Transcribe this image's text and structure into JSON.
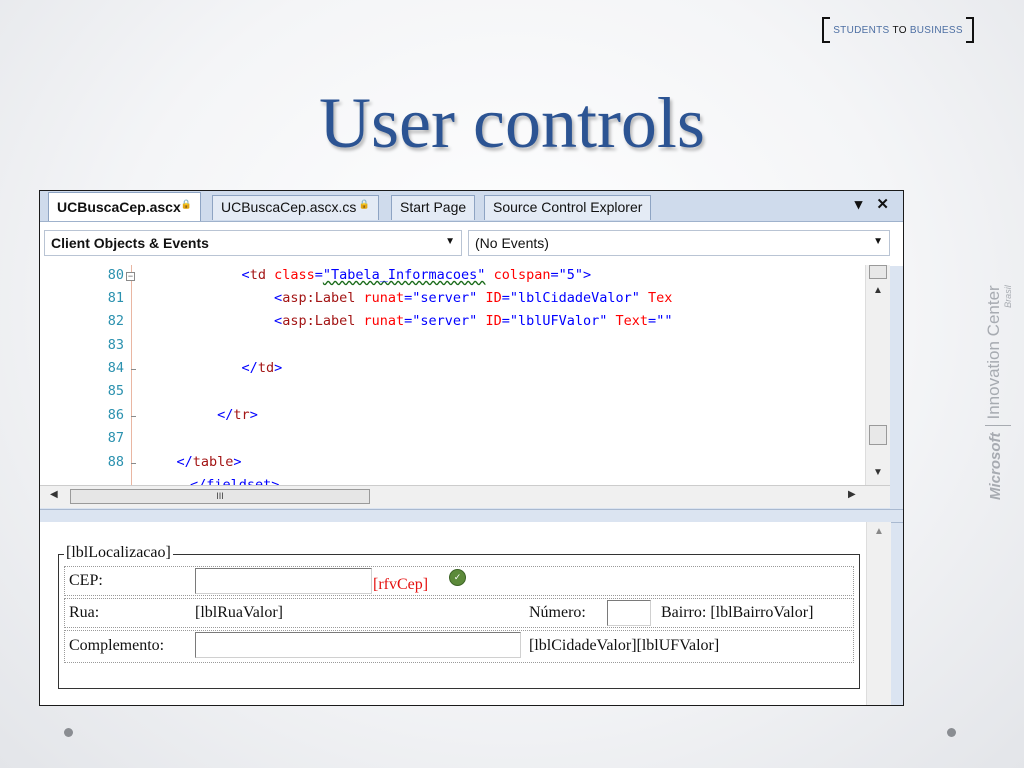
{
  "badge": {
    "students": "STUDENTS",
    "to": "TO",
    "business": "BUSINESS"
  },
  "title": "User controls",
  "side_label": {
    "microsoft": "Microsoft",
    "innovation": "Innovation Center",
    "brasil": "Brasil"
  },
  "ide": {
    "tabs": [
      {
        "label": "UCBuscaCep.ascx",
        "active": true
      },
      {
        "label": "UCBuscaCep.ascx.cs",
        "active": false
      },
      {
        "label": "Start Page",
        "active": false
      },
      {
        "label": "Source Control Explorer",
        "active": false
      }
    ],
    "window_buttons": {
      "dropdown": "▾",
      "close": "✕"
    },
    "combos": {
      "left": "Client Objects & Events",
      "right": "(No Events)"
    },
    "line_numbers": [
      "80",
      "81",
      "82",
      "83",
      "84",
      "85",
      "86",
      "87",
      "88"
    ],
    "code": {
      "l80": {
        "indent": "            ",
        "open": "<",
        "tag": "td",
        "a1": "class",
        "v1": "\"Tabela_Informacoes\"",
        "a2": "colspan",
        "v2": "\"5\"",
        "close": ">"
      },
      "l81": {
        "indent": "                ",
        "open": "<",
        "tag": "asp:Label",
        "a1": "runat",
        "v1": "\"server\"",
        "a2": "ID",
        "v2": "\"lblCidadeValor\"",
        "a3": "Tex"
      },
      "l82": {
        "indent": "                ",
        "open": "<",
        "tag": "asp:Label",
        "a1": "runat",
        "v1": "\"server\"",
        "a2": "ID",
        "v2": "\"lblUFValor\"",
        "a3": "Text",
        "v3": "\"\""
      },
      "l84": {
        "indent": "            ",
        "open": "</",
        "tag": "td",
        "close": ">"
      },
      "l86": {
        "indent": "         ",
        "open": "</",
        "tag": "tr",
        "close": ">"
      },
      "l88": {
        "indent": "    ",
        "open": "</",
        "tag": "table",
        "close": ">"
      },
      "l89": {
        "indent": "",
        "text": "</fieldset>"
      }
    },
    "hscroll_grip": "III",
    "design": {
      "legend": "[lblLocalizacao]",
      "cep_label": "CEP:",
      "rfv": "[rfvCep]",
      "rua_label": "Rua:",
      "rua_value": "[lblRuaValor]",
      "numero_label": "Número:",
      "bairro": "Bairro: [lblBairroValor]",
      "complemento_label": "Complemento:",
      "cidade_uf": "[lblCidadeValor][lblUFValor]"
    }
  },
  "colors": {
    "title": "#2c5493",
    "badge_accent": "#4d6fa3",
    "code_tag": "#a31515",
    "code_attr": "#ff0000",
    "code_value": "#0000ff",
    "line_number": "#2b91af",
    "validator": "#e4100f"
  }
}
